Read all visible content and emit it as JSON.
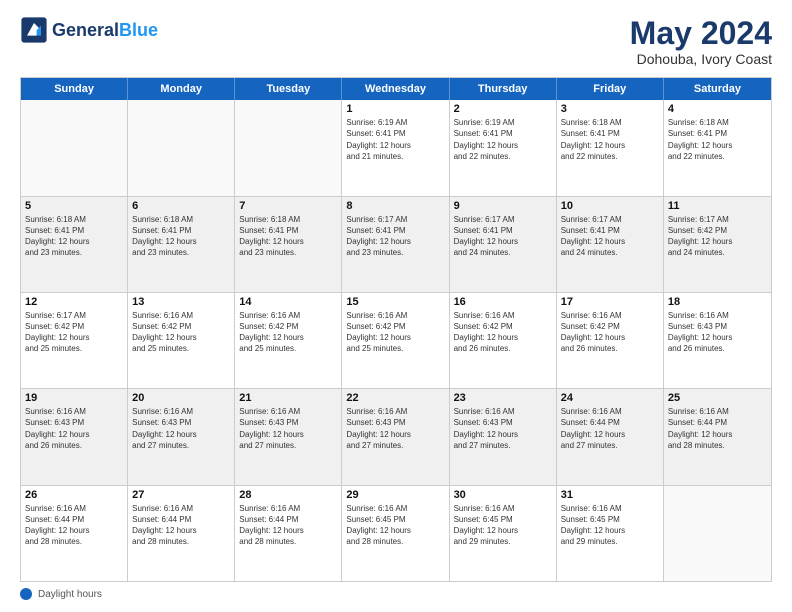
{
  "logo": {
    "text_general": "General",
    "text_blue": "Blue"
  },
  "header": {
    "month": "May 2024",
    "location": "Dohouba, Ivory Coast"
  },
  "days_of_week": [
    "Sunday",
    "Monday",
    "Tuesday",
    "Wednesday",
    "Thursday",
    "Friday",
    "Saturday"
  ],
  "weeks": [
    [
      {
        "day": "",
        "info": "",
        "empty": true
      },
      {
        "day": "",
        "info": "",
        "empty": true
      },
      {
        "day": "",
        "info": "",
        "empty": true
      },
      {
        "day": "1",
        "info": "Sunrise: 6:19 AM\nSunset: 6:41 PM\nDaylight: 12 hours\nand 21 minutes.",
        "empty": false
      },
      {
        "day": "2",
        "info": "Sunrise: 6:19 AM\nSunset: 6:41 PM\nDaylight: 12 hours\nand 22 minutes.",
        "empty": false
      },
      {
        "day": "3",
        "info": "Sunrise: 6:18 AM\nSunset: 6:41 PM\nDaylight: 12 hours\nand 22 minutes.",
        "empty": false
      },
      {
        "day": "4",
        "info": "Sunrise: 6:18 AM\nSunset: 6:41 PM\nDaylight: 12 hours\nand 22 minutes.",
        "empty": false
      }
    ],
    [
      {
        "day": "5",
        "info": "Sunrise: 6:18 AM\nSunset: 6:41 PM\nDaylight: 12 hours\nand 23 minutes.",
        "empty": false
      },
      {
        "day": "6",
        "info": "Sunrise: 6:18 AM\nSunset: 6:41 PM\nDaylight: 12 hours\nand 23 minutes.",
        "empty": false
      },
      {
        "day": "7",
        "info": "Sunrise: 6:18 AM\nSunset: 6:41 PM\nDaylight: 12 hours\nand 23 minutes.",
        "empty": false
      },
      {
        "day": "8",
        "info": "Sunrise: 6:17 AM\nSunset: 6:41 PM\nDaylight: 12 hours\nand 23 minutes.",
        "empty": false
      },
      {
        "day": "9",
        "info": "Sunrise: 6:17 AM\nSunset: 6:41 PM\nDaylight: 12 hours\nand 24 minutes.",
        "empty": false
      },
      {
        "day": "10",
        "info": "Sunrise: 6:17 AM\nSunset: 6:41 PM\nDaylight: 12 hours\nand 24 minutes.",
        "empty": false
      },
      {
        "day": "11",
        "info": "Sunrise: 6:17 AM\nSunset: 6:42 PM\nDaylight: 12 hours\nand 24 minutes.",
        "empty": false
      }
    ],
    [
      {
        "day": "12",
        "info": "Sunrise: 6:17 AM\nSunset: 6:42 PM\nDaylight: 12 hours\nand 25 minutes.",
        "empty": false
      },
      {
        "day": "13",
        "info": "Sunrise: 6:16 AM\nSunset: 6:42 PM\nDaylight: 12 hours\nand 25 minutes.",
        "empty": false
      },
      {
        "day": "14",
        "info": "Sunrise: 6:16 AM\nSunset: 6:42 PM\nDaylight: 12 hours\nand 25 minutes.",
        "empty": false
      },
      {
        "day": "15",
        "info": "Sunrise: 6:16 AM\nSunset: 6:42 PM\nDaylight: 12 hours\nand 25 minutes.",
        "empty": false
      },
      {
        "day": "16",
        "info": "Sunrise: 6:16 AM\nSunset: 6:42 PM\nDaylight: 12 hours\nand 26 minutes.",
        "empty": false
      },
      {
        "day": "17",
        "info": "Sunrise: 6:16 AM\nSunset: 6:42 PM\nDaylight: 12 hours\nand 26 minutes.",
        "empty": false
      },
      {
        "day": "18",
        "info": "Sunrise: 6:16 AM\nSunset: 6:43 PM\nDaylight: 12 hours\nand 26 minutes.",
        "empty": false
      }
    ],
    [
      {
        "day": "19",
        "info": "Sunrise: 6:16 AM\nSunset: 6:43 PM\nDaylight: 12 hours\nand 26 minutes.",
        "empty": false
      },
      {
        "day": "20",
        "info": "Sunrise: 6:16 AM\nSunset: 6:43 PM\nDaylight: 12 hours\nand 27 minutes.",
        "empty": false
      },
      {
        "day": "21",
        "info": "Sunrise: 6:16 AM\nSunset: 6:43 PM\nDaylight: 12 hours\nand 27 minutes.",
        "empty": false
      },
      {
        "day": "22",
        "info": "Sunrise: 6:16 AM\nSunset: 6:43 PM\nDaylight: 12 hours\nand 27 minutes.",
        "empty": false
      },
      {
        "day": "23",
        "info": "Sunrise: 6:16 AM\nSunset: 6:43 PM\nDaylight: 12 hours\nand 27 minutes.",
        "empty": false
      },
      {
        "day": "24",
        "info": "Sunrise: 6:16 AM\nSunset: 6:44 PM\nDaylight: 12 hours\nand 27 minutes.",
        "empty": false
      },
      {
        "day": "25",
        "info": "Sunrise: 6:16 AM\nSunset: 6:44 PM\nDaylight: 12 hours\nand 28 minutes.",
        "empty": false
      }
    ],
    [
      {
        "day": "26",
        "info": "Sunrise: 6:16 AM\nSunset: 6:44 PM\nDaylight: 12 hours\nand 28 minutes.",
        "empty": false
      },
      {
        "day": "27",
        "info": "Sunrise: 6:16 AM\nSunset: 6:44 PM\nDaylight: 12 hours\nand 28 minutes.",
        "empty": false
      },
      {
        "day": "28",
        "info": "Sunrise: 6:16 AM\nSunset: 6:44 PM\nDaylight: 12 hours\nand 28 minutes.",
        "empty": false
      },
      {
        "day": "29",
        "info": "Sunrise: 6:16 AM\nSunset: 6:45 PM\nDaylight: 12 hours\nand 28 minutes.",
        "empty": false
      },
      {
        "day": "30",
        "info": "Sunrise: 6:16 AM\nSunset: 6:45 PM\nDaylight: 12 hours\nand 29 minutes.",
        "empty": false
      },
      {
        "day": "31",
        "info": "Sunrise: 6:16 AM\nSunset: 6:45 PM\nDaylight: 12 hours\nand 29 minutes.",
        "empty": false
      },
      {
        "day": "",
        "info": "",
        "empty": true
      }
    ]
  ],
  "footer": {
    "label": "Daylight hours"
  }
}
